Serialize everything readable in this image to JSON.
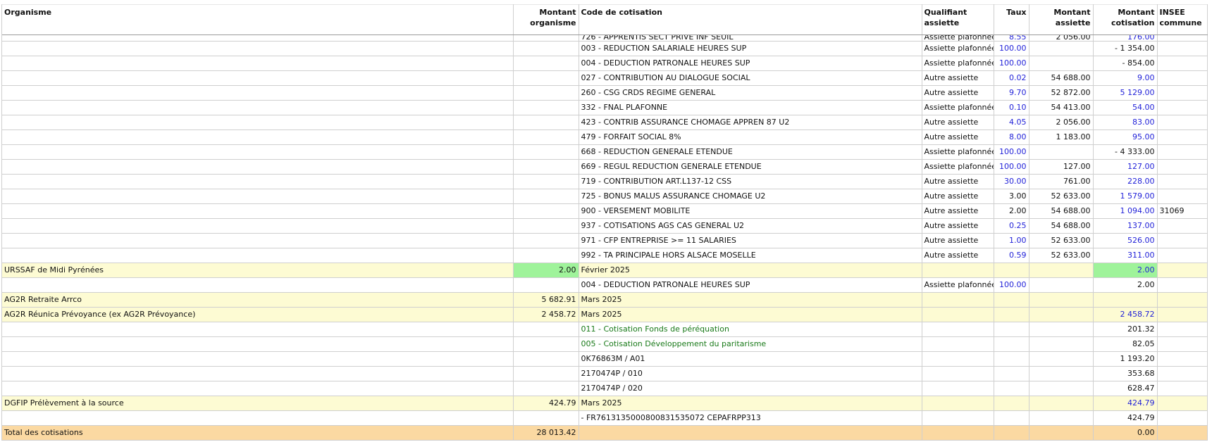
{
  "headers": {
    "organisme": "Organisme",
    "montant_organisme": "Montant organisme",
    "code_cotisation": "Code de cotisation",
    "qualifiant_assiette": "Qualifiant assiette",
    "taux": "Taux",
    "montant_assiette": "Montant assiette",
    "montant_cotisation": "Montant cotisation",
    "insee_commune": "INSEE commune"
  },
  "rows": [
    {
      "type": "detail",
      "code": "726 - APPRENTIS SECT PRIVE INF SEUIL",
      "qualifiant": "Assiette plafonnée",
      "taux": "8.55",
      "taux_color": "blue",
      "assiette": "2 056.00",
      "cotisation": "176.00",
      "cot_color": "blue"
    },
    {
      "type": "detail",
      "code": "003 - REDUCTION SALARIALE HEURES SUP",
      "qualifiant": "Assiette plafonnée",
      "taux": "100.00",
      "taux_color": "blue",
      "assiette": "",
      "cotisation": "- 1 354.00"
    },
    {
      "type": "detail",
      "code": "004 - DEDUCTION PATRONALE HEURES SUP",
      "qualifiant": "Assiette plafonnée",
      "taux": "100.00",
      "taux_color": "blue",
      "assiette": "",
      "cotisation": "- 854.00"
    },
    {
      "type": "detail",
      "code": "027 - CONTRIBUTION AU DIALOGUE SOCIAL",
      "qualifiant": "Autre assiette",
      "taux": "0.02",
      "taux_color": "blue",
      "assiette": "54 688.00",
      "cotisation": "9.00",
      "cot_color": "blue"
    },
    {
      "type": "detail",
      "code": "260 - CSG CRDS REGIME GENERAL",
      "qualifiant": "Autre assiette",
      "taux": "9.70",
      "taux_color": "blue",
      "assiette": "52 872.00",
      "cotisation": "5 129.00",
      "cot_color": "blue"
    },
    {
      "type": "detail",
      "code": "332 - FNAL PLAFONNE",
      "qualifiant": "Assiette plafonnée",
      "taux": "0.10",
      "taux_color": "blue",
      "assiette": "54 413.00",
      "cotisation": "54.00",
      "cot_color": "blue"
    },
    {
      "type": "detail",
      "code": "423 - CONTRIB ASSURANCE CHOMAGE APPREN 87 U2",
      "qualifiant": "Autre assiette",
      "taux": "4.05",
      "taux_color": "blue",
      "assiette": "2 056.00",
      "cotisation": "83.00",
      "cot_color": "blue"
    },
    {
      "type": "detail",
      "code": "479 - FORFAIT SOCIAL 8%",
      "qualifiant": "Autre assiette",
      "taux": "8.00",
      "taux_color": "blue",
      "assiette": "1 183.00",
      "cotisation": "95.00",
      "cot_color": "blue"
    },
    {
      "type": "detail",
      "code": "668 - REDUCTION GENERALE ETENDUE",
      "qualifiant": "Assiette plafonnée",
      "taux": "100.00",
      "taux_color": "blue",
      "assiette": "",
      "cotisation": "- 4 333.00"
    },
    {
      "type": "detail",
      "code": "669 - REGUL REDUCTION GENERALE ETENDUE",
      "qualifiant": "Assiette plafonnée",
      "taux": "100.00",
      "taux_color": "blue",
      "assiette": "127.00",
      "cotisation": "127.00",
      "cot_color": "blue"
    },
    {
      "type": "detail",
      "code": "719 - CONTRIBUTION ART.L137-12 CSS",
      "qualifiant": "Autre assiette",
      "taux": "30.00",
      "taux_color": "blue",
      "assiette": "761.00",
      "cotisation": "228.00",
      "cot_color": "blue"
    },
    {
      "type": "detail",
      "code": "725 - BONUS MALUS ASSURANCE CHOMAGE U2",
      "qualifiant": "Autre assiette",
      "taux": "3.00",
      "assiette": "52 633.00",
      "cotisation": "1 579.00",
      "cot_color": "blue"
    },
    {
      "type": "detail",
      "code": "900 - VERSEMENT MOBILITE",
      "qualifiant": "Autre assiette",
      "taux": "2.00",
      "assiette": "54 688.00",
      "cotisation": "1 094.00",
      "cot_color": "blue",
      "insee": "31069"
    },
    {
      "type": "detail",
      "code": "937 - COTISATIONS AGS CAS GENERAL U2",
      "qualifiant": "Autre assiette",
      "taux": "0.25",
      "taux_color": "blue",
      "assiette": "54 688.00",
      "cotisation": "137.00",
      "cot_color": "blue"
    },
    {
      "type": "detail",
      "code": "971 - CFP ENTREPRISE >= 11 SALARIES",
      "qualifiant": "Autre assiette",
      "taux": "1.00",
      "taux_color": "blue",
      "assiette": "52 633.00",
      "cotisation": "526.00",
      "cot_color": "blue"
    },
    {
      "type": "detail",
      "code": "992 - TA PRINCIPALE HORS ALSACE MOSELLE",
      "qualifiant": "Autre assiette",
      "taux": "0.59",
      "taux_color": "blue",
      "assiette": "52 633.00",
      "cotisation": "311.00",
      "cot_color": "blue"
    },
    {
      "type": "org",
      "organisme": "URSSAF de Midi Pyrénées",
      "montant": "2.00",
      "montant_hl": "green",
      "code": "Février 2025",
      "cotisation": "2.00",
      "cot_color": "blue",
      "cot_hl": "green"
    },
    {
      "type": "detail",
      "code": "004 - DEDUCTION PATRONALE HEURES SUP",
      "qualifiant": "Assiette plafonnée",
      "taux": "100.00",
      "taux_color": "blue",
      "assiette": "",
      "cotisation": "2.00"
    },
    {
      "type": "org",
      "organisme": "AG2R Retraite Arrco",
      "montant": "5 682.91",
      "code": "Mars 2025",
      "cotisation": ""
    },
    {
      "type": "org",
      "organisme": "AG2R Réunica Prévoyance (ex AG2R Prévoyance)",
      "montant": "2 458.72",
      "code": "Mars 2025",
      "cotisation": "2 458.72",
      "cot_color": "blue"
    },
    {
      "type": "detail",
      "code": "011 - Cotisation Fonds de péréquation",
      "code_color": "green",
      "cotisation": "201.32"
    },
    {
      "type": "detail",
      "code": "005 - Cotisation Développement du paritarisme",
      "code_color": "green",
      "cotisation": "82.05"
    },
    {
      "type": "detail",
      "code": "0K76863M / A01",
      "cotisation": "1 193.20"
    },
    {
      "type": "detail",
      "code": "2170474P / 010",
      "cotisation": "353.68"
    },
    {
      "type": "detail",
      "code": "2170474P / 020",
      "cotisation": "628.47"
    },
    {
      "type": "org",
      "organisme": "DGFIP Prélèvement à la source",
      "montant": "424.79",
      "code": "Mars 2025",
      "cotisation": "424.79",
      "cot_color": "blue"
    },
    {
      "type": "detail",
      "code": " - FR7613135000800831535072 CEPAFRPP313",
      "cotisation": "424.79"
    },
    {
      "type": "total",
      "organisme": "Total des cotisations",
      "montant": "28 013.42",
      "code": "",
      "cotisation": "0.00"
    }
  ]
}
